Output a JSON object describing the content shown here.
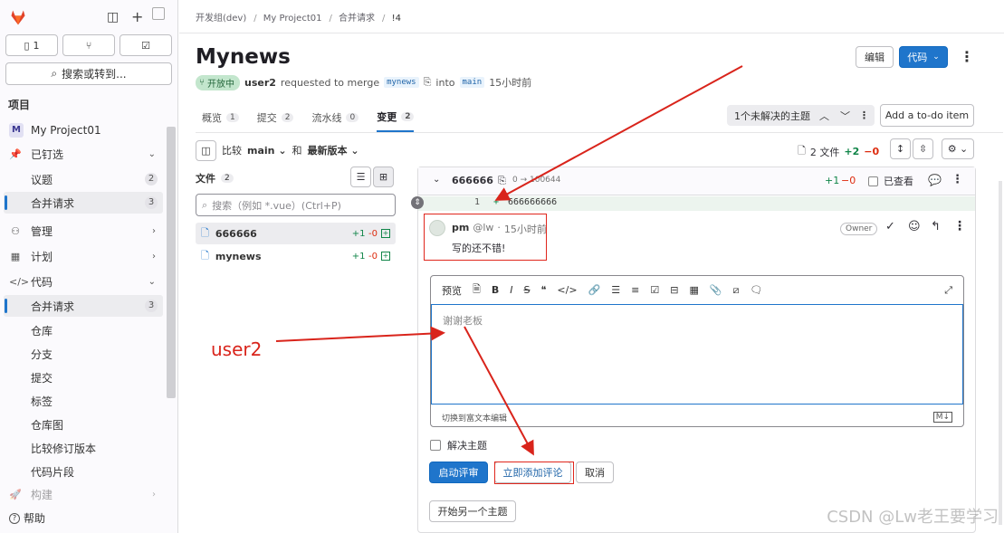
{
  "sidebar": {
    "counts": {
      "issues": "1",
      "mrs": "",
      "todos": ""
    },
    "search_label": "搜索或转到...",
    "section_title": "项目",
    "project_initial": "M",
    "project_name": "My Project01",
    "items": [
      {
        "label": "已钉选",
        "chev": "⌄"
      },
      {
        "label": "议题",
        "badge": "2"
      },
      {
        "label": "合并请求",
        "badge": "3"
      },
      {
        "label": "管理",
        "chev": "›"
      },
      {
        "label": "计划",
        "chev": "›"
      },
      {
        "label": "代码",
        "chev": "⌄"
      },
      {
        "label": "合并请求",
        "badge": "3"
      },
      {
        "label": "仓库"
      },
      {
        "label": "分支"
      },
      {
        "label": "提交"
      },
      {
        "label": "标签"
      },
      {
        "label": "仓库图"
      },
      {
        "label": "比较修订版本"
      },
      {
        "label": "代码片段"
      },
      {
        "label": "构建",
        "chev": "›"
      }
    ],
    "help_label": "帮助"
  },
  "breadcrumbs": [
    "开发组(dev)",
    "My Project01",
    "合并请求",
    "!4"
  ],
  "mr": {
    "title": "Mynews",
    "status": "开放中",
    "author": "user2",
    "requested_text": "requested to merge",
    "source_branch": "mynews",
    "into_text": "into",
    "target_branch": "main",
    "time": "15小时前"
  },
  "header_buttons": {
    "edit": "编辑",
    "code": "代码"
  },
  "tabs": [
    {
      "label": "概览",
      "count": "1"
    },
    {
      "label": "提交",
      "count": "2"
    },
    {
      "label": "流水线",
      "count": "0"
    },
    {
      "label": "变更",
      "count": "2"
    }
  ],
  "unresolved": "1个未解决的主题",
  "todo_button": "Add a to-do item",
  "compare": {
    "label": "比较",
    "base": "main",
    "and": "和",
    "head": "最新版本"
  },
  "diff_stats": {
    "files": "2 文件",
    "added": "+2",
    "removed": "−0"
  },
  "files": {
    "label": "文件",
    "count": "2",
    "search_placeholder": "搜索（例如 *.vue）(Ctrl+P)",
    "list": [
      {
        "name": "666666",
        "added": "+1",
        "removed": "-0"
      },
      {
        "name": "mynews",
        "added": "+1",
        "removed": "-0"
      }
    ]
  },
  "diff": {
    "file_name": "666666",
    "mode": "0 → 100644",
    "added": "+1",
    "removed": "−0",
    "viewed_label": "已查看",
    "line_number": "1",
    "line_marker": "+",
    "line_content": "666666666"
  },
  "comment": {
    "author": "pm",
    "handle": "@lw",
    "time": "15小时前",
    "role": "Owner",
    "body": "写的还不错!"
  },
  "editor": {
    "preview_tab": "预览",
    "reply_text": "谢谢老板",
    "footer": "切换到富文本编辑",
    "resolve_label": "解决主题",
    "start_review": "启动评审",
    "add_comment_now": "立即添加评论",
    "cancel": "取消",
    "new_thread": "开始另一个主题"
  },
  "annotation": {
    "user_label": "user2",
    "color": "#d9241b"
  },
  "watermark": "CSDN @Lw老王要学习",
  "colors": {
    "accent": "#1f75cb",
    "added": "#108548",
    "removed": "#dd2b0e"
  }
}
